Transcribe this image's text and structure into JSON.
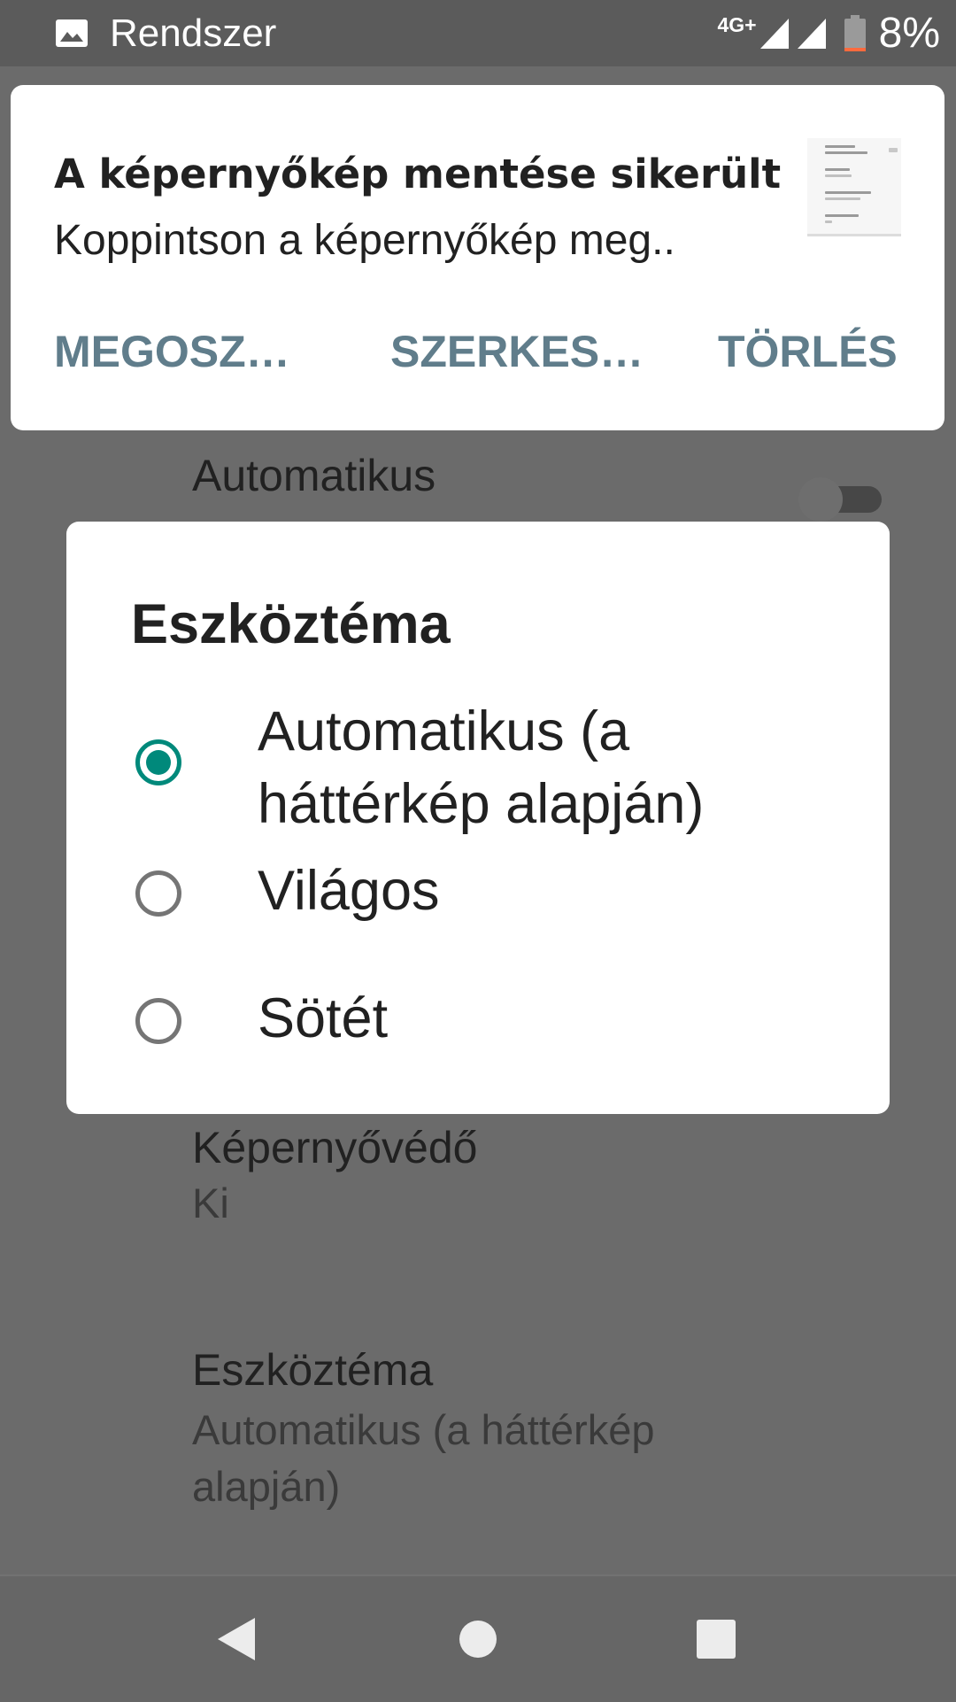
{
  "status_bar": {
    "app_name": "Rendszer",
    "network": "4G+",
    "battery": "8%",
    "battery_level": 0.08
  },
  "settings": {
    "items": [
      {
        "title": "Automatikus"
      },
      {
        "title": "Képernyővédő",
        "summary": "Ki"
      },
      {
        "title": "Eszköztéma",
        "summary": "Automatikus (a háttérkép alapján)"
      }
    ]
  },
  "notification": {
    "title": "A képernyőkép mentése sikerült",
    "text": "Koppintson a képernyőkép meg..",
    "actions": [
      "MEGOSZ…",
      "SZERKES…",
      "TÖRLÉS"
    ]
  },
  "dialog": {
    "title": "Eszköztéma",
    "options": [
      {
        "label": "Automatikus (a háttérkép alapján)",
        "selected": true
      },
      {
        "label": "Világos",
        "selected": false
      },
      {
        "label": "Sötét",
        "selected": false
      }
    ]
  },
  "colors": {
    "accent": "#00897b",
    "action_text": "#607d8b",
    "scrim": "#6b6b6b"
  },
  "icons": {
    "status_left": "image-icon",
    "signal": "signal-icon",
    "battery": "battery-icon",
    "nav": [
      "back-icon",
      "home-icon",
      "recents-icon"
    ]
  }
}
